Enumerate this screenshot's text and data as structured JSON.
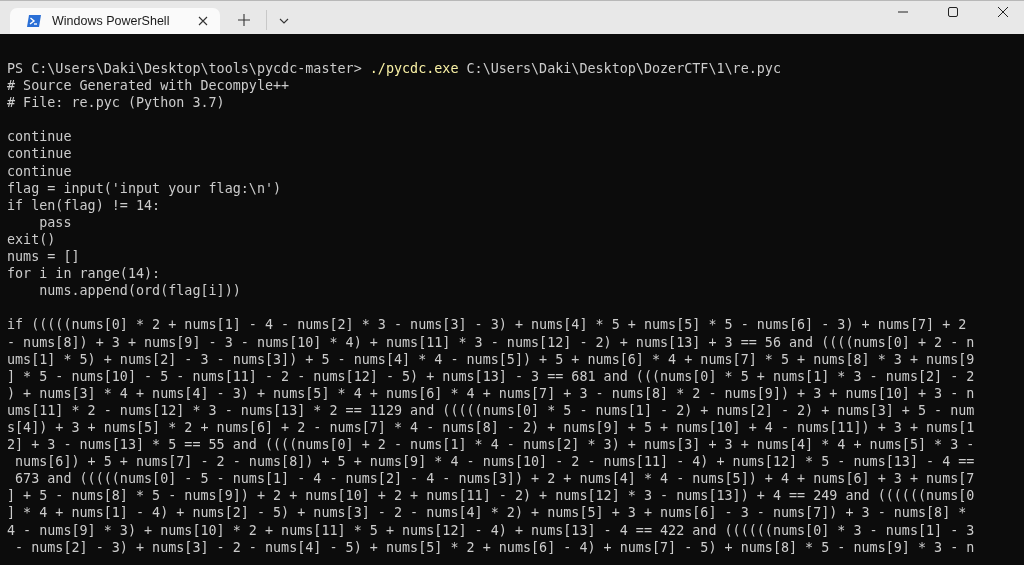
{
  "window": {
    "tabs": [
      {
        "title": "Windows PowerShell",
        "selected": true
      }
    ]
  },
  "terminal": {
    "command_line": {
      "prompt": "PS C:\\Users\\Daki\\Desktop\\tools\\pycdc-master>",
      "command": "./pycdc.exe",
      "argument": "C:\\Users\\Daki\\Desktop\\DozerCTF\\1\\re.pyc"
    },
    "blocks": [
      [
        "# Source Generated with Decompyle++",
        "# File: re.pyc (Python 3.7)"
      ],
      [
        "continue",
        "continue",
        "continue",
        "flag = input('input your flag:\\n')",
        "if len(flag) != 14:",
        "    pass",
        "exit()",
        "nums = []",
        "for i in range(14):",
        "    nums.append(ord(flag[i]))"
      ],
      [
        "if (((((nums[0] * 2 + nums[1] - 4 - nums[2] * 3 - nums[3] - 3) + nums[4] * 5 + nums[5] * 5 - nums[6] - 3) + nums[7] + 2",
        "- nums[8]) + 3 + nums[9] - 3 - nums[10] * 4) + nums[11] * 3 - nums[12] - 2) + nums[13] + 3 == 56 and ((((nums[0] + 2 - n",
        "ums[1] * 5) + nums[2] - 3 - nums[3]) + 5 - nums[4] * 4 - nums[5]) + 5 + nums[6] * 4 + nums[7] * 5 + nums[8] * 3 + nums[9",
        "] * 5 - nums[10] - 5 - nums[11] - 2 - nums[12] - 5) + nums[13] - 3 == 681 and (((nums[0] * 5 + nums[1] * 3 - nums[2] - 2",
        ") + nums[3] * 4 + nums[4] - 3) + nums[5] * 4 + nums[6] * 4 + nums[7] + 3 - nums[8] * 2 - nums[9]) + 3 + nums[10] + 3 - n",
        "ums[11] * 2 - nums[12] * 3 - nums[13] * 2 == 1129 and (((((nums[0] * 5 - nums[1] - 2) + nums[2] - 2) + nums[3] + 5 - num",
        "s[4]) + 3 + nums[5] * 2 + nums[6] + 2 - nums[7] * 4 - nums[8] - 2) + nums[9] + 5 + nums[10] + 4 - nums[11]) + 3 + nums[1",
        "2] + 3 - nums[13] * 5 == 55 and ((((nums[0] + 2 - nums[1] * 4 - nums[2] * 3) + nums[3] + 3 + nums[4] * 4 + nums[5] * 3 -",
        " nums[6]) + 5 + nums[7] - 2 - nums[8]) + 5 + nums[9] * 4 - nums[10] - 2 - nums[11] - 4) + nums[12] * 5 - nums[13] - 4 ==",
        " 673 and (((((nums[0] - 5 - nums[1] - 4 - nums[2] - 4 - nums[3]) + 2 + nums[4] * 4 - nums[5]) + 4 + nums[6] + 3 + nums[7",
        "] + 5 - nums[8] * 5 - nums[9]) + 2 + nums[10] + 2 + nums[11] - 2) + nums[12] * 3 - nums[13]) + 4 == 249 and ((((((nums[0",
        "] * 4 + nums[1] - 4) + nums[2] - 5) + nums[3] - 2 - nums[4] * 2) + nums[5] + 3 + nums[6] - 3 - nums[7]) + 3 - nums[8] *",
        "4 - nums[9] * 3) + nums[10] * 2 + nums[11] * 5 + nums[12] - 4) + nums[13] - 4 == 422 and ((((((nums[0] * 3 - nums[1] - 3",
        " - nums[2] - 3) + nums[3] - 2 - nums[4] - 5) + nums[5] * 2 + nums[6] - 4) + nums[7] - 5) + nums[8] * 5 - nums[9] * 3 - n"
      ]
    ]
  }
}
